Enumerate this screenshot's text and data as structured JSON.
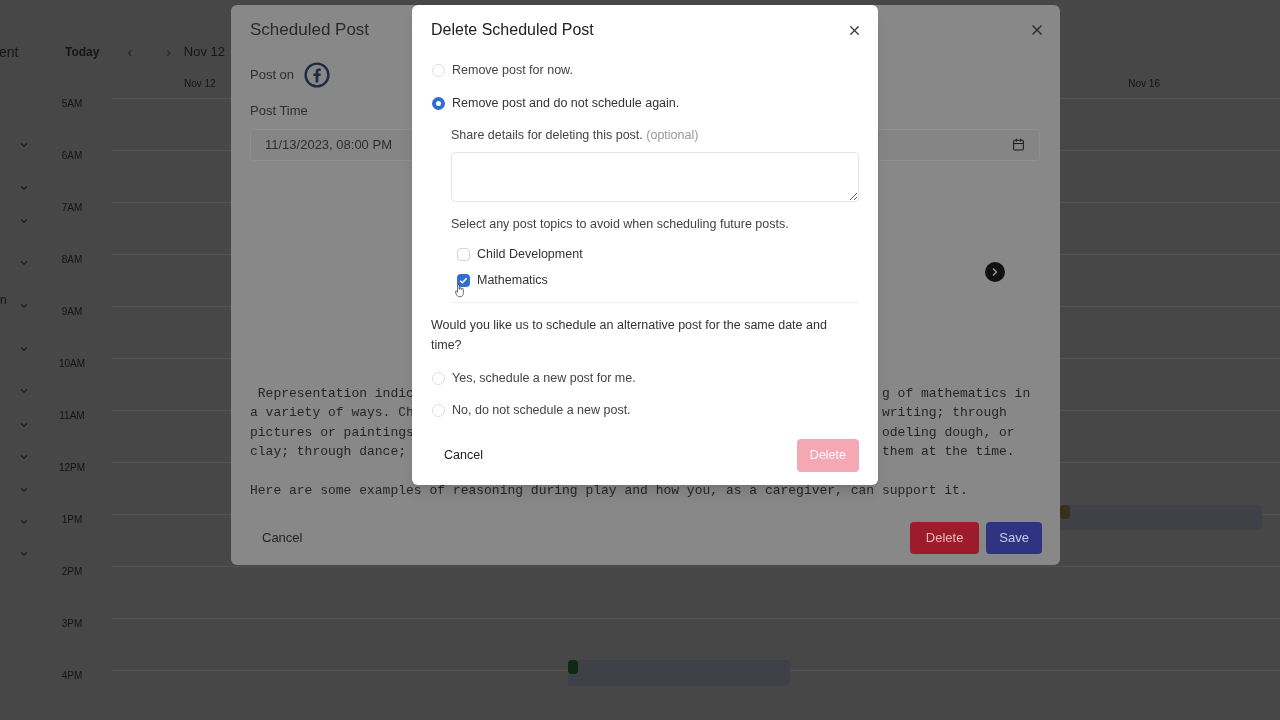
{
  "calendar": {
    "sidebar_heading": "ent",
    "sidebar_fragment": "n",
    "today_button": "Today",
    "prev_button": "‹",
    "next_button": "›",
    "range_title": "Nov 12",
    "day_headers": [
      "Nov 12",
      "Nov 16"
    ],
    "hours": [
      "5AM",
      "6AM",
      "7AM",
      "8AM",
      "9AM",
      "10AM",
      "11AM",
      "12PM",
      "1PM",
      "2PM",
      "3PM",
      "4PM"
    ],
    "events": [
      {
        "color": "#3a2e1c"
      },
      {
        "color": "#0f2a12"
      }
    ]
  },
  "scheduled_post_dialog": {
    "title": "Scheduled Post",
    "post_on_label": "Post on",
    "post_time_label": "Post Time",
    "post_time_value": "11/13/2023, 08:00 PM",
    "paragraphs": [
      {
        "lines": [
          {
            "left": " Representation indic",
            "right": "g of mathematics in"
          },
          {
            "left": "a variety of ways. Ch",
            "right": "writing; through"
          },
          {
            "left": "pictures or paintings",
            "right": "odeling dough, or"
          },
          {
            "left": "clay; through dance;",
            "right": "them at the time."
          }
        ]
      },
      {
        "lines": [
          {
            "left": "Here are some examples of reasoning during play and how you, as a caregiver, can support it."
          }
        ]
      }
    ],
    "buttons": [
      {
        "kind": "cancel",
        "label": "Cancel"
      },
      {
        "kind": "danger",
        "label": "Delete"
      },
      {
        "kind": "primary",
        "label": "Save"
      }
    ]
  },
  "delete_dialog": {
    "title": "Delete Scheduled Post",
    "removal_options": [
      {
        "label": "Remove post for now.",
        "selected": false
      },
      {
        "label": "Remove post and do not schedule again.",
        "selected": true
      }
    ],
    "details_label": "Share details for deleting this post.",
    "details_hint": "(optional)",
    "topics_prompt": "Select any post topics to avoid when scheduling future posts.",
    "topics": [
      {
        "label": "Child Development",
        "checked": false
      },
      {
        "label": "Mathematics",
        "checked": true
      }
    ],
    "alternative_question": "Would you like us to schedule an alternative post for the same date and time?",
    "alternative_options": [
      {
        "label": "Yes, schedule a new post for me.",
        "selected": false
      },
      {
        "label": "No, do not schedule a new post.",
        "selected": false
      }
    ],
    "cancel_button": "Cancel",
    "delete_button": {
      "label": "Delete",
      "disabled": true
    }
  }
}
